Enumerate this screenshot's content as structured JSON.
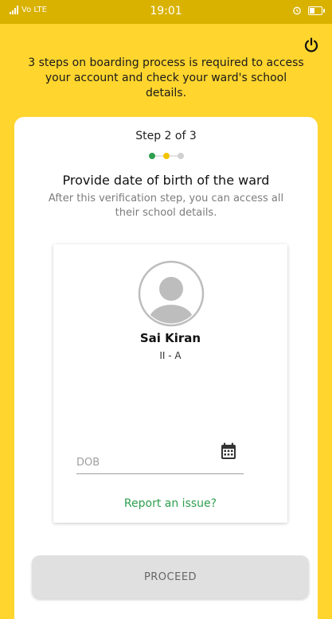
{
  "status_bar": {
    "left_text": "Vo LTE",
    "time": "19:01"
  },
  "intro": {
    "text": "3 steps on boarding process is required to access your account and check your ward's school details."
  },
  "step": {
    "label": "Step 2 of 3",
    "current": 2,
    "total": 3,
    "colors": {
      "done": "#2E9E4F",
      "current": "#F2C400",
      "pending": "#D0D0D0"
    }
  },
  "verification": {
    "heading": "Provide date of birth of the ward",
    "subtext": "After this verification step, you can access all their school details."
  },
  "student": {
    "name": "Sai Kiran",
    "class": "II - A"
  },
  "dob_field": {
    "placeholder": "DOB",
    "value": ""
  },
  "report_link": "Report an issue?",
  "proceed_label": "PROCEED",
  "icons": {
    "power": "power-icon",
    "calendar": "calendar-icon",
    "avatar": "user-avatar-icon"
  },
  "colors": {
    "background": "#FFD52E",
    "link": "#2E9E4F",
    "button_disabled": "#E0E0E0"
  }
}
